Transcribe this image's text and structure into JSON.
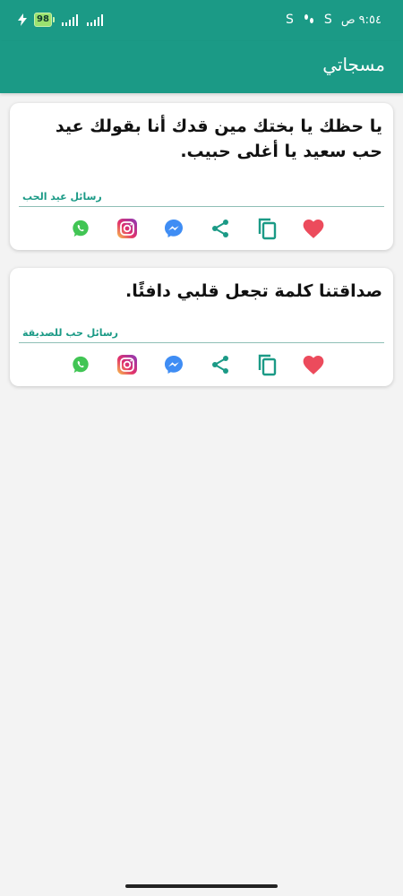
{
  "status_bar": {
    "time": "٩:٥٤ ص",
    "battery_level": "98",
    "icons": [
      "charging-icon",
      "signal-icon",
      "signal-icon",
      "s-icon",
      "walk-icon",
      "s-icon"
    ]
  },
  "app_bar": {
    "title": "مسجاتي"
  },
  "messages": [
    {
      "text": "يا حظك يا بختك مين قدك أنا بقولك عيد حب سعيد يا أغلى حبيب.",
      "category": "رسائل عيد الحب"
    },
    {
      "text": "صداقتنا كلمة تجعل قلبي دافئًا.",
      "category": "رسائل حب للصديقة"
    }
  ],
  "colors": {
    "accent": "#1b9a86",
    "heart": "#ec4b5c",
    "whatsapp": "#41c554",
    "messenger": "#3f8df4"
  },
  "actions": [
    "whatsapp-icon",
    "instagram-icon",
    "messenger-icon",
    "share-icon",
    "copy-icon",
    "heart-icon"
  ]
}
